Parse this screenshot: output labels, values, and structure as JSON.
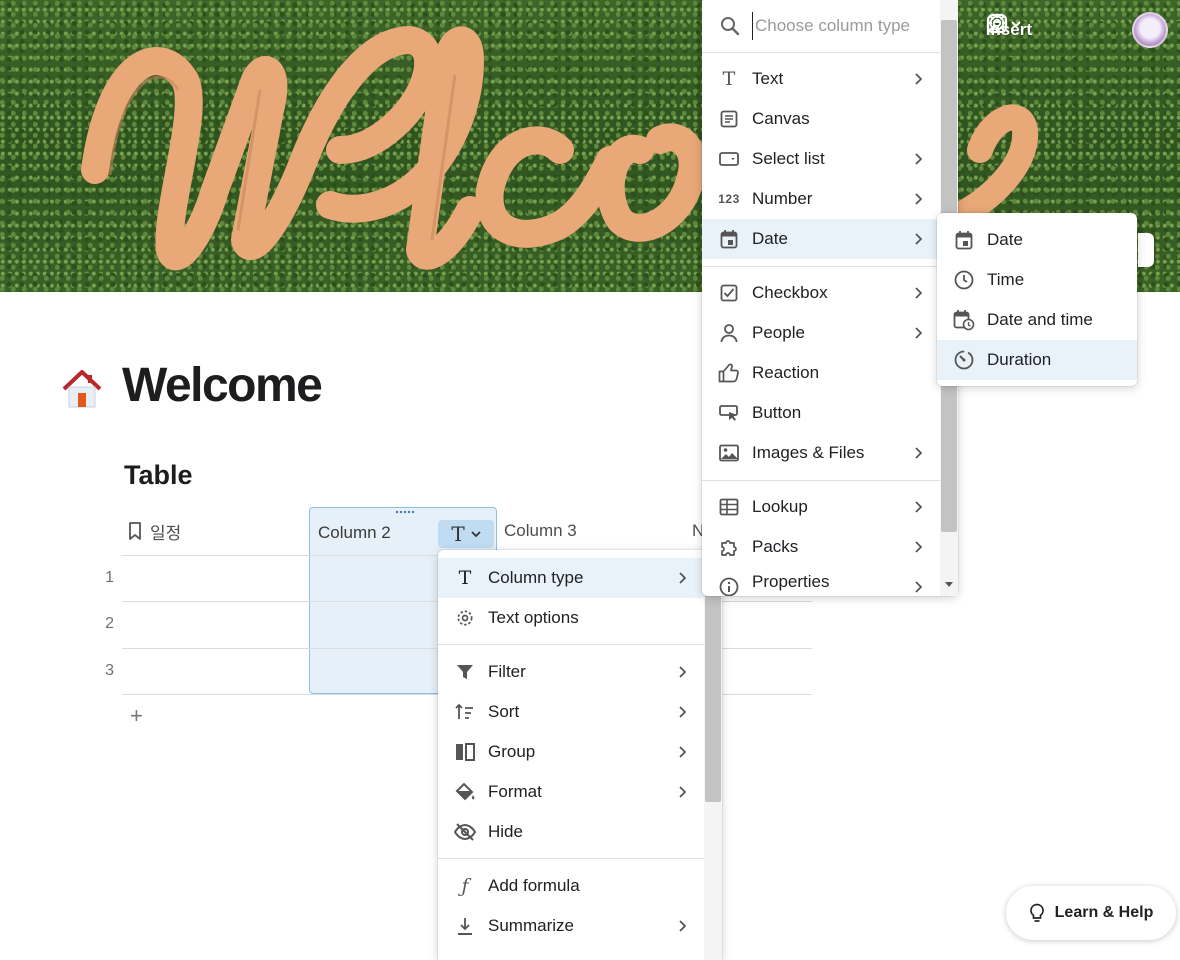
{
  "topbar": {
    "insert_label": "Insert"
  },
  "page": {
    "title": "Welcome",
    "table_title": "Table"
  },
  "table": {
    "columns": [
      "일정",
      "Column 2",
      "Column 3",
      "N"
    ],
    "rows": [
      "1",
      "2",
      "3"
    ],
    "add_row_symbol": "+"
  },
  "column_menu": {
    "items": [
      {
        "label": "Column type",
        "icon": "text-type-icon",
        "submenu": true,
        "highlighted": true
      },
      {
        "label": "Text options",
        "icon": "gear-icon",
        "submenu": false
      },
      {
        "label": "Filter",
        "icon": "filter-icon",
        "submenu": true
      },
      {
        "label": "Sort",
        "icon": "sort-icon",
        "submenu": true
      },
      {
        "label": "Group",
        "icon": "group-icon",
        "submenu": true
      },
      {
        "label": "Format",
        "icon": "paint-bucket-icon",
        "submenu": true
      },
      {
        "label": "Hide",
        "icon": "eye-off-icon",
        "submenu": false
      },
      {
        "label": "Add formula",
        "icon": "formula-icon",
        "submenu": false
      },
      {
        "label": "Summarize",
        "icon": "summarize-icon",
        "submenu": true
      }
    ]
  },
  "type_menu": {
    "search_placeholder": "Choose column type",
    "items": [
      {
        "label": "Text",
        "icon": "text-icon",
        "submenu": true
      },
      {
        "label": "Canvas",
        "icon": "canvas-icon",
        "submenu": false
      },
      {
        "label": "Select list",
        "icon": "select-list-icon",
        "submenu": true
      },
      {
        "label": "Number",
        "icon": "number-icon",
        "glyph": "123",
        "submenu": true
      },
      {
        "label": "Date",
        "icon": "calendar-icon",
        "submenu": true,
        "highlighted": true
      },
      {
        "label": "Checkbox",
        "icon": "checkbox-icon",
        "submenu": true
      },
      {
        "label": "People",
        "icon": "person-icon",
        "submenu": true
      },
      {
        "label": "Reaction",
        "icon": "thumbs-up-icon",
        "submenu": false
      },
      {
        "label": "Button",
        "icon": "button-icon",
        "submenu": false
      },
      {
        "label": "Images & Files",
        "icon": "image-icon",
        "submenu": true
      },
      {
        "label": "Lookup",
        "icon": "lookup-table-icon",
        "submenu": true
      },
      {
        "label": "Packs",
        "icon": "puzzle-icon",
        "submenu": true
      },
      {
        "label": "Properties",
        "icon": "info-icon",
        "submenu": true
      }
    ]
  },
  "date_submenu": {
    "items": [
      {
        "label": "Date",
        "icon": "calendar-icon"
      },
      {
        "label": "Time",
        "icon": "clock-icon"
      },
      {
        "label": "Date and time",
        "icon": "calendar-clock-icon"
      },
      {
        "label": "Duration",
        "icon": "timer-icon",
        "highlighted": true
      }
    ]
  },
  "help": {
    "label": "Learn & Help"
  },
  "colors": {
    "accent": "#8cc0e4",
    "highlight": "#e9f2f9",
    "column_fill": "#e6f0f8"
  }
}
